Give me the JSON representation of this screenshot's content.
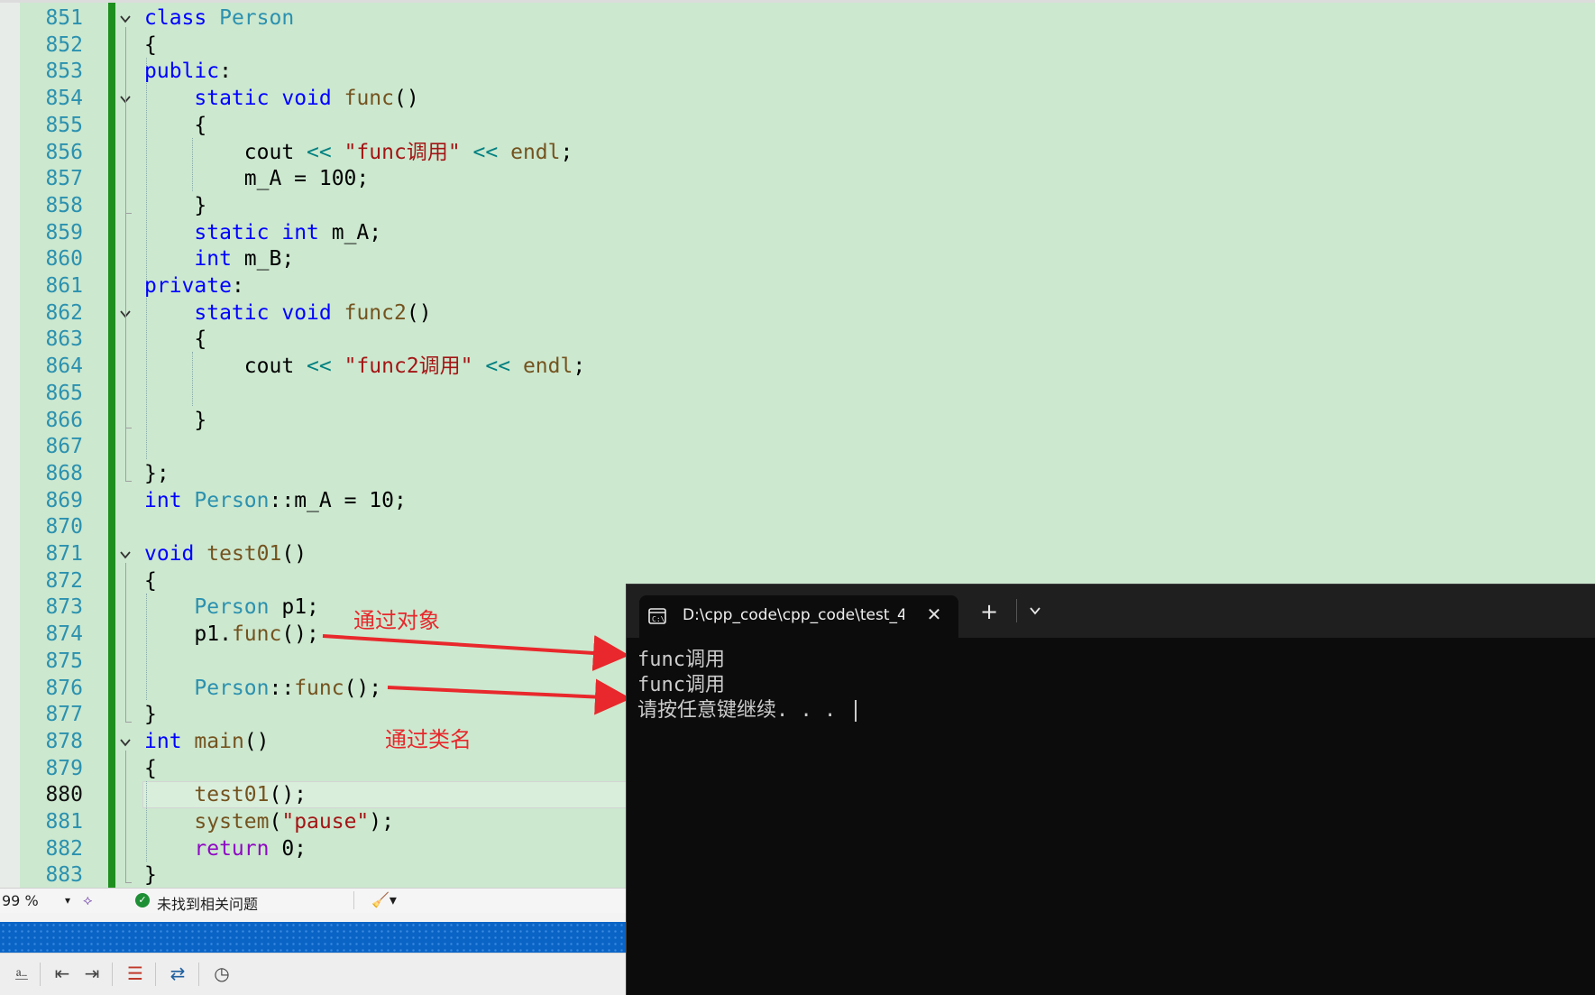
{
  "editor": {
    "current_line": "880",
    "lines": [
      {
        "num": "851",
        "tokens": [
          [
            "kw",
            "class"
          ],
          [
            "pl",
            " "
          ],
          [
            "ty",
            "Person"
          ]
        ]
      },
      {
        "num": "852",
        "tokens": [
          [
            "pl",
            "{"
          ]
        ]
      },
      {
        "num": "853",
        "tokens": [
          [
            "kw",
            "public"
          ],
          [
            "pl",
            ":"
          ]
        ]
      },
      {
        "num": "854",
        "tokens": [
          [
            "pl",
            "    "
          ],
          [
            "kw",
            "static"
          ],
          [
            "pl",
            " "
          ],
          [
            "kw",
            "void"
          ],
          [
            "pl",
            " "
          ],
          [
            "fn",
            "func"
          ],
          [
            "pl",
            "()"
          ]
        ]
      },
      {
        "num": "855",
        "tokens": [
          [
            "pl",
            "    {"
          ]
        ]
      },
      {
        "num": "856",
        "tokens": [
          [
            "pl",
            "        cout "
          ],
          [
            "op",
            "<<"
          ],
          [
            "pl",
            " "
          ],
          [
            "st",
            "\"func调用\""
          ],
          [
            "pl",
            " "
          ],
          [
            "op",
            "<<"
          ],
          [
            "pl",
            " "
          ],
          [
            "fn",
            "endl"
          ],
          [
            "pl",
            ";"
          ]
        ]
      },
      {
        "num": "857",
        "tokens": [
          [
            "pl",
            "        m_A = 100;"
          ]
        ]
      },
      {
        "num": "858",
        "tokens": [
          [
            "pl",
            "    }"
          ]
        ]
      },
      {
        "num": "859",
        "tokens": [
          [
            "pl",
            "    "
          ],
          [
            "kw",
            "static"
          ],
          [
            "pl",
            " "
          ],
          [
            "kw",
            "int"
          ],
          [
            "pl",
            " m_A;"
          ]
        ]
      },
      {
        "num": "860",
        "tokens": [
          [
            "pl",
            "    "
          ],
          [
            "kw",
            "int"
          ],
          [
            "pl",
            " m_B;"
          ]
        ]
      },
      {
        "num": "861",
        "tokens": [
          [
            "kw",
            "private"
          ],
          [
            "pl",
            ":"
          ]
        ]
      },
      {
        "num": "862",
        "tokens": [
          [
            "pl",
            "    "
          ],
          [
            "kw",
            "static"
          ],
          [
            "pl",
            " "
          ],
          [
            "kw",
            "void"
          ],
          [
            "pl",
            " "
          ],
          [
            "fn",
            "func2"
          ],
          [
            "pl",
            "()"
          ]
        ]
      },
      {
        "num": "863",
        "tokens": [
          [
            "pl",
            "    {"
          ]
        ]
      },
      {
        "num": "864",
        "tokens": [
          [
            "pl",
            "        cout "
          ],
          [
            "op",
            "<<"
          ],
          [
            "pl",
            " "
          ],
          [
            "st",
            "\"func2调用\""
          ],
          [
            "pl",
            " "
          ],
          [
            "op",
            "<<"
          ],
          [
            "pl",
            " "
          ],
          [
            "fn",
            "endl"
          ],
          [
            "pl",
            ";"
          ]
        ]
      },
      {
        "num": "865",
        "tokens": []
      },
      {
        "num": "866",
        "tokens": [
          [
            "pl",
            "    }"
          ]
        ]
      },
      {
        "num": "867",
        "tokens": []
      },
      {
        "num": "868",
        "tokens": [
          [
            "pl",
            "};"
          ]
        ]
      },
      {
        "num": "869",
        "tokens": [
          [
            "kw",
            "int"
          ],
          [
            "pl",
            " "
          ],
          [
            "ty",
            "Person"
          ],
          [
            "pl",
            "::m_A = 10;"
          ]
        ]
      },
      {
        "num": "870",
        "tokens": []
      },
      {
        "num": "871",
        "tokens": [
          [
            "kw",
            "void"
          ],
          [
            "pl",
            " "
          ],
          [
            "fn",
            "test01"
          ],
          [
            "pl",
            "()"
          ]
        ]
      },
      {
        "num": "872",
        "tokens": [
          [
            "pl",
            "{"
          ]
        ]
      },
      {
        "num": "873",
        "tokens": [
          [
            "pl",
            "    "
          ],
          [
            "ty",
            "Person"
          ],
          [
            "pl",
            " "
          ],
          [
            "pl",
            "p1"
          ],
          [
            "pl",
            ";"
          ]
        ]
      },
      {
        "num": "874",
        "tokens": [
          [
            "pl",
            "    p1."
          ],
          [
            "fn",
            "func"
          ],
          [
            "pl",
            "();"
          ]
        ]
      },
      {
        "num": "875",
        "tokens": []
      },
      {
        "num": "876",
        "tokens": [
          [
            "pl",
            "    "
          ],
          [
            "ty",
            "Person"
          ],
          [
            "pl",
            "::"
          ],
          [
            "fn",
            "func"
          ],
          [
            "pl",
            "();"
          ]
        ]
      },
      {
        "num": "877",
        "tokens": [
          [
            "pl",
            "}"
          ]
        ]
      },
      {
        "num": "878",
        "tokens": [
          [
            "kw",
            "int"
          ],
          [
            "pl",
            " "
          ],
          [
            "fn",
            "main"
          ],
          [
            "pl",
            "()"
          ]
        ]
      },
      {
        "num": "879",
        "tokens": [
          [
            "pl",
            "{"
          ]
        ]
      },
      {
        "num": "880",
        "tokens": [
          [
            "pl",
            "    "
          ],
          [
            "fn",
            "test01"
          ],
          [
            "pl",
            "();"
          ]
        ]
      },
      {
        "num": "881",
        "tokens": [
          [
            "pl",
            "    "
          ],
          [
            "fn",
            "system"
          ],
          [
            "pl",
            "("
          ],
          [
            "st",
            "\"pause\""
          ],
          [
            "pl",
            ");"
          ]
        ]
      },
      {
        "num": "882",
        "tokens": [
          [
            "pl",
            "    "
          ],
          [
            "mb",
            "return"
          ],
          [
            "pl",
            " 0;"
          ]
        ]
      },
      {
        "num": "883",
        "tokens": [
          [
            "pl",
            "}"
          ]
        ]
      }
    ]
  },
  "annotations": {
    "via_object": "通过对象",
    "via_class": "通过类名"
  },
  "status": {
    "zoom": "99 %",
    "issues": "未找到相关问题"
  },
  "terminal": {
    "tab_title": "D:\\cpp_code\\cpp_code\\test_4_",
    "output": [
      "func调用",
      "func调用",
      "请按任意键继续. . . "
    ]
  },
  "colors": {
    "editor_bg": "#cce8cf",
    "keyword": "#0000ff",
    "type": "#2b91af",
    "function": "#74531f",
    "string": "#a31515",
    "annotation": "#e8282c",
    "terminal_bg": "#0c0c0c",
    "progress": "#0a64c6"
  },
  "icons": {
    "fold": "chevron-down-icon",
    "issues": "check-circle-icon",
    "terminal": "cmd-icon",
    "close": "close-icon",
    "new_tab": "plus-icon",
    "dropdown": "chevron-down-icon"
  }
}
